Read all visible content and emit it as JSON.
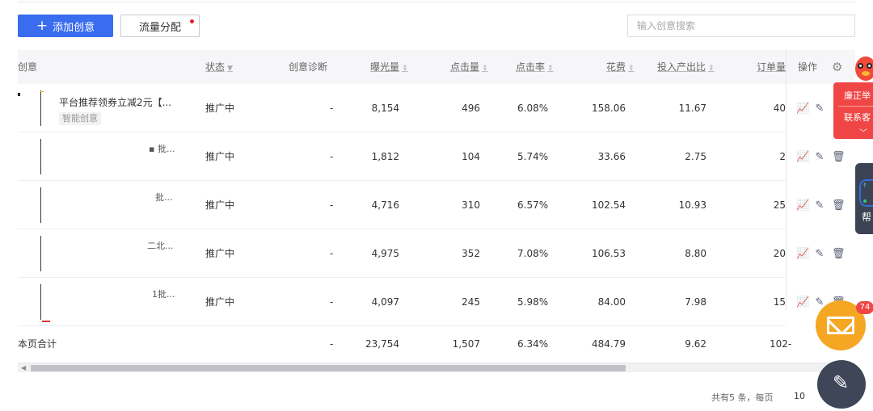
{
  "toolbar": {
    "add_label": "添加创意",
    "traffic_label": "流量分配",
    "search_placeholder": "输入创意搜索"
  },
  "table": {
    "headers": {
      "creative": "创意",
      "status": "状态",
      "diagnosis": "创意诊断",
      "impressions": "曝光量",
      "clicks": "点击量",
      "ctr": "点击率",
      "cost": "花费",
      "roi": "投入产出比",
      "orders": "订单量",
      "ops": "操作"
    },
    "rows": [
      {
        "name": "平台推荐领券立减2元【...",
        "tag": "智能创意",
        "frag": "",
        "status": "推广中",
        "diagnosis": "-",
        "impressions": "8,154",
        "clicks": "496",
        "ctr": "6.08%",
        "cost": "158.06",
        "roi": "11.67",
        "orders": "40"
      },
      {
        "name": "",
        "tag": "",
        "frag": "▪ 批...",
        "status": "推广中",
        "diagnosis": "-",
        "impressions": "1,812",
        "clicks": "104",
        "ctr": "5.74%",
        "cost": "33.66",
        "roi": "2.75",
        "orders": "2"
      },
      {
        "name": "",
        "tag": "",
        "frag": "批...",
        "status": "推广中",
        "diagnosis": "-",
        "impressions": "4,716",
        "clicks": "310",
        "ctr": "6.57%",
        "cost": "102.54",
        "roi": "10.93",
        "orders": "25"
      },
      {
        "name": "",
        "tag": "",
        "frag": "二北...",
        "status": "推广中",
        "diagnosis": "-",
        "impressions": "4,975",
        "clicks": "352",
        "ctr": "7.08%",
        "cost": "106.53",
        "roi": "8.80",
        "orders": "20"
      },
      {
        "name": "",
        "tag": "",
        "frag": "1批...",
        "status": "推广中",
        "diagnosis": "-",
        "impressions": "4,097",
        "clicks": "245",
        "ctr": "5.98%",
        "cost": "84.00",
        "roi": "7.98",
        "orders": "15"
      }
    ],
    "total": {
      "label": "本页合计",
      "diagnosis": "-",
      "impressions": "23,754",
      "clicks": "1,507",
      "ctr": "6.34%",
      "cost": "484.79",
      "roi": "9.62",
      "orders": "102-"
    }
  },
  "pager": {
    "summary": "共有5 条，每页",
    "page_size": "10"
  },
  "floating": {
    "promo_line1": "廉正举",
    "promo_line2": "联系客",
    "help_label": "帮",
    "mail_badge": "74"
  },
  "icons": {
    "chart": "chart-icon",
    "edit": "edit-icon",
    "delete": "trash-icon",
    "settings": "gear-icon",
    "mail": "mail-icon"
  },
  "colors": {
    "primary": "#3a6cf0",
    "badge_red": "#e0202a",
    "promo_red": "#f04646",
    "mail_orange": "#f5a623",
    "dark_float": "#3f4658"
  }
}
